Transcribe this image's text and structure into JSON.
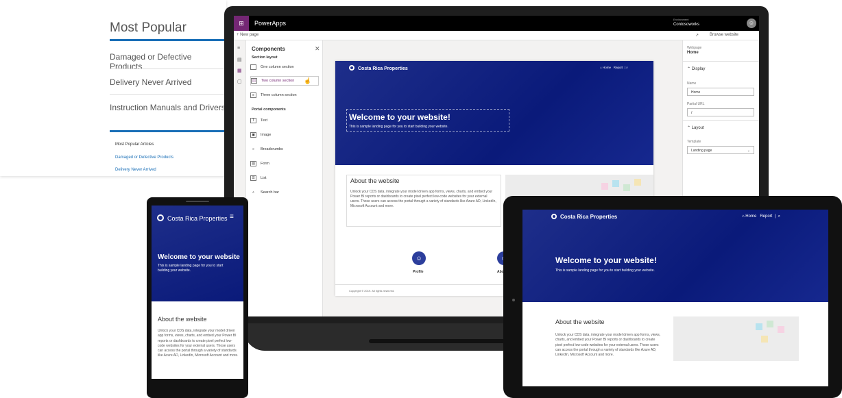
{
  "background_card": {
    "title": "Most Popular",
    "links": [
      "Damaged or Defective Products",
      "Delivery Never Arrived",
      "Instruction Manuals and Drivers"
    ],
    "section_title": "Most Popular Articles",
    "small_links": [
      "Damaged or Defective Products",
      "Delivery Never Arrived"
    ]
  },
  "app": {
    "name": "PowerApps",
    "environment_label": "Environment",
    "environment_name": "Contosoworks",
    "new_page": "+ New page",
    "browse_website": "Browse website"
  },
  "components": {
    "title": "Components",
    "section_layout": "Section layout",
    "layout_items": [
      "One column section",
      "Two column section",
      "Three column section"
    ],
    "portal_components": "Portal components",
    "portal_items": [
      "Text",
      "Image",
      "Breadcrumbs",
      "Form",
      "List",
      "Search bar"
    ]
  },
  "site": {
    "name": "Costa Rica Properties",
    "nav_home": "Home",
    "nav_report": "Report",
    "welcome_title": "Welcome to your website!",
    "welcome_sub": "This is sample landing page for you to start building your website.",
    "about_title": "About the website",
    "about_text": "Unlock your CDS data, integrate your model driven app forms, views, charts, and embed your Power BI reports or dashboards to create pixel perfect low-code websites for your external users.  Those users can access the portal through a variety of standards like Azure AD, LinkedIn, Microsoft Account and more.",
    "profile_label": "Profile",
    "profile2_label": "Abo",
    "copyright": "Copyright © 2019. All rights reserved."
  },
  "properties": {
    "webpage_label": "Webpage",
    "webpage_value": "Home",
    "display": "Display",
    "name_label": "Name",
    "name_value": "Home",
    "partial_url_label": "Partial URL",
    "partial_url_value": "/",
    "layout": "Layout",
    "template_label": "Template",
    "template_value": "Landing page"
  },
  "phone": {
    "site_name": "Costa Rica Properties",
    "welcome_title": "Welcome to your website",
    "welcome_sub": "This is sample landing page for you to start building your website.",
    "about_title": "About the website",
    "about_text": "Unlock your CDS data, integrate your model driven app forms, views, charts, and embed your Power BI reports or dashboards to create pixel perfect low-code websites for your external users. Those users can access the portal through a variety of standards like Azure AD, LinkedIn, Microsoft Account and more."
  },
  "tablet": {
    "site_name": "Costa Rica Properties",
    "nav_home": "Home",
    "nav_report": "Report",
    "welcome_title": "Welcome to your website!",
    "welcome_sub": "This is sample landing page for you to start building your website.",
    "about_title": "About the website",
    "about_text": "Unlock your CDS data, integrate your model driven app forms, views, charts, and embed your Power BI reports or dashboards to create pixel perfect low-code websites for your external users. Those users can access the portal through a variety of standards like Azure AD, LinkedIn, Microsoft Account and more."
  },
  "colors": {
    "brand_purple": "#742774",
    "hero_blue": "#0a1a7a",
    "link_blue": "#1a6fb7"
  }
}
